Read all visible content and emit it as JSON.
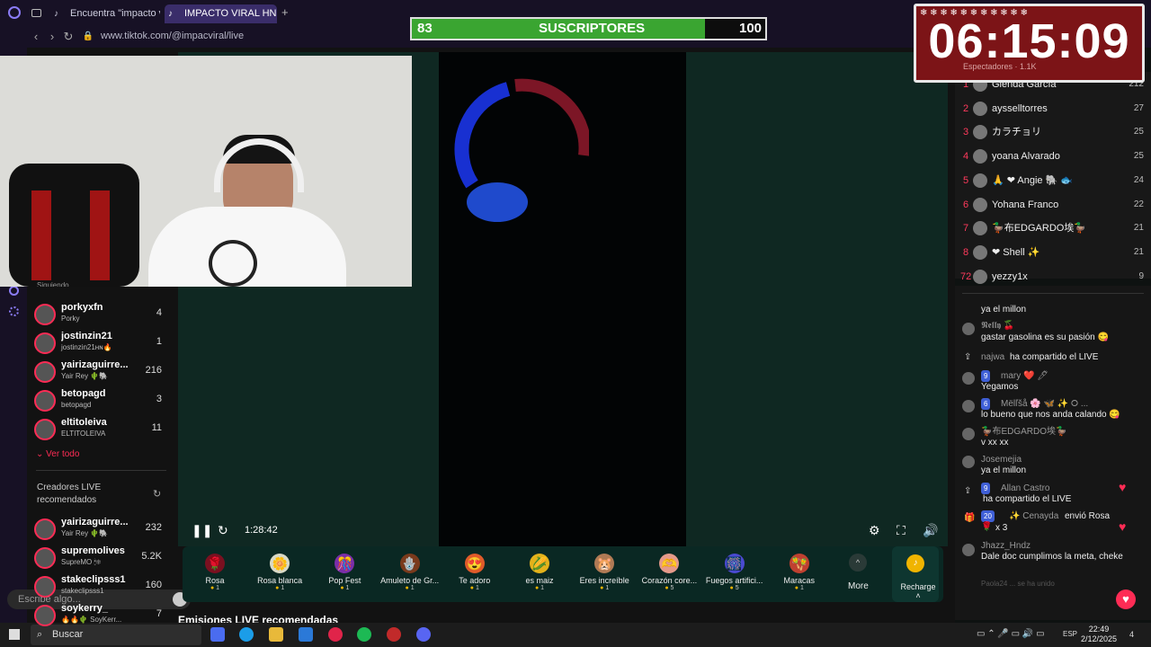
{
  "browser": {
    "tab1": "Encuentra \"impacto viral\"",
    "tab2": "IMPACTO VIRAL HN (",
    "url": "www.tiktok.com/@impacviral/live"
  },
  "overlay": {
    "subs_current": "83",
    "subs_label": "SUSCRIPTORES",
    "subs_goal": "100",
    "subs_progress": 0.83,
    "timer": "06:15:09",
    "timer_sub": "Espectadores · 1.1K"
  },
  "ranking": [
    {
      "n": "1",
      "name": "Glenda García",
      "v": "212"
    },
    {
      "n": "2",
      "name": "aysselltorres",
      "v": "27"
    },
    {
      "n": "3",
      "name": "カラチョリ",
      "v": "25"
    },
    {
      "n": "4",
      "name": "yoana Alvarado",
      "v": "25"
    },
    {
      "n": "5",
      "name": "🙏 ❤ Angie 🐘 🐟",
      "v": "24"
    },
    {
      "n": "6",
      "name": "Yohana Franco",
      "v": "22"
    },
    {
      "n": "7",
      "name": "🦆布EDGARDO埃🦆",
      "v": "21"
    },
    {
      "n": "8",
      "name": "❤ Shell ✨",
      "v": "21"
    },
    {
      "n": "72",
      "name": "yezzy1x",
      "v": "9"
    }
  ],
  "chat": {
    "m1": "ya el millon",
    "m2_user": "𝕹𝖊𝖑𝖑𝖞 🍒",
    "m2_text": "gastar gasolina es su pasión 😋",
    "m3_user": "najwa",
    "m3_text": "ha compartido el LIVE",
    "m4_user": "mary ❤️ 🖊",
    "m4_level": "9",
    "m4_text": "Yegamos",
    "m5_user": "Mëlľšå 🌸 🦋 ✨ ⭘ ...",
    "m5_level": "6",
    "m5_text": "lo bueno que nos anda calando 😋",
    "m6_user": "🦆布EDGARDO埃🦆",
    "m6_text": "v xx xx",
    "m7_user": "Josemejia",
    "m7_text": "ya el millon",
    "m8_user": "Allan Castro",
    "m8_level": "9",
    "m8_text": "ha compartido el LIVE",
    "m9_user": "✨ Cenayda",
    "m9_level": "20",
    "m9_text": "envió Rosa",
    "m9_count": "x 3",
    "m10_user": "Jhazz_Hndz",
    "m10_text": "Dale doc cumplimos la meta, cheke",
    "m11": "Paola24 ... se ha unido",
    "input_placeholder": "Escribe algo..."
  },
  "sidebar": {
    "heading": "Siguiendo",
    "following": [
      {
        "name": "porkyxfn",
        "sub": "Porky",
        "v": "4"
      },
      {
        "name": "jostinzin21",
        "sub": "jostinzin21ʜɴ🔥",
        "v": "1"
      },
      {
        "name": "yairizaguirre...",
        "sub": "Yair Rey 🌵🐘",
        "v": "216"
      },
      {
        "name": "betopagd",
        "sub": "betopagd",
        "v": "3"
      },
      {
        "name": "eltitoleiva",
        "sub": "ELTITOLEIVA",
        "v": "11"
      }
    ],
    "ver_todo": "Ver todo",
    "recommended_title": "Creadores LIVE recomendados",
    "recommended": [
      {
        "name": "yairizaguirre...",
        "sub": "Yair Rey 🌵🐘",
        "v": "232"
      },
      {
        "name": "supremolives",
        "sub": "SupreMO 🕯❄",
        "v": "5.2K"
      },
      {
        "name": "stakeclipsss1",
        "sub": "stakeclipsss1",
        "v": "160"
      },
      {
        "name": "soykerry_",
        "sub": "🔥🔥🌵 SoyKerr...",
        "v": "7"
      }
    ]
  },
  "player": {
    "time": "1:28:42"
  },
  "gifts": [
    {
      "name": "Rosa",
      "price": "1",
      "icon": "🌹",
      "color": "#7a1020"
    },
    {
      "name": "Rosa blanca",
      "price": "1",
      "icon": "🌼",
      "color": "#d9d9c6"
    },
    {
      "name": "Pop Fest",
      "price": "1",
      "icon": "🎊",
      "color": "#7b2ea8"
    },
    {
      "name": "Amuleto de Gr...",
      "price": "1",
      "icon": "🪬",
      "color": "#7a3a1c"
    },
    {
      "name": "Te adoro",
      "price": "1",
      "icon": "😍",
      "color": "#e05a2a"
    },
    {
      "name": "es maiz",
      "price": "1",
      "icon": "🌽",
      "color": "#e3b21b"
    },
    {
      "name": "Eres increíble",
      "price": "1",
      "icon": "🐹",
      "color": "#b07a55"
    },
    {
      "name": "Corazón core...",
      "price": "5",
      "icon": "🫶",
      "color": "#e59a8a"
    },
    {
      "name": "Fuegos artifici...",
      "price": "5",
      "icon": "🎆",
      "color": "#4a4ad0"
    },
    {
      "name": "Maracas",
      "price": "1",
      "icon": "🪇",
      "color": "#c04030"
    }
  ],
  "gift_more": "More",
  "recharge": "Recharge",
  "section_title": "Emisiones LIVE recomendadas",
  "taskbar": {
    "search": "Buscar",
    "lang": "ESP",
    "time": "22:49",
    "date": "2/12/2025",
    "notif": "4"
  }
}
